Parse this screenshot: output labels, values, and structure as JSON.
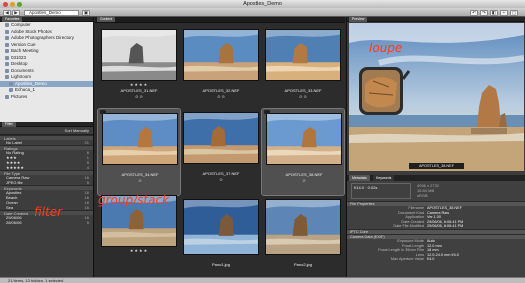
{
  "window": {
    "title": "Apostles_Demo"
  },
  "toolbar": {
    "path_label": "Apostles_Demo",
    "back_label": "◀",
    "fwd_label": "▶"
  },
  "left": {
    "folders_tab": "Favorites",
    "folders": [
      {
        "label": "Computer"
      },
      {
        "label": "Adobe Stock Photos"
      },
      {
        "label": "Adobe Photographers Directory"
      },
      {
        "label": "Version Cue"
      },
      {
        "label": "Bach Meeting"
      },
      {
        "label": "031023"
      },
      {
        "label": "Desktop"
      },
      {
        "label": "Documents"
      },
      {
        "label": "Lightroom"
      },
      {
        "label": "Apostles_Demo",
        "selected": true
      },
      {
        "label": "Echuca_1"
      },
      {
        "label": "Pictures"
      }
    ],
    "filter_tab": "Filter",
    "sort_label": "Sort Manually",
    "groups": [
      {
        "title": "Labels",
        "rows": [
          {
            "label": "No Label",
            "count": "21"
          }
        ]
      },
      {
        "title": "Ratings",
        "rows": [
          {
            "label": "No Rating",
            "count": "6"
          },
          {
            "label": "★★★",
            "count": "1"
          },
          {
            "label": "★★★★",
            "count": "5"
          },
          {
            "label": "★★★★★",
            "count": "4"
          }
        ]
      },
      {
        "title": "File Type",
        "rows": [
          {
            "label": "Camera Raw",
            "count": "16"
          },
          {
            "label": "JPEG file",
            "count": "5"
          }
        ]
      },
      {
        "title": "Keywords",
        "rows": [
          {
            "label": "Apostles",
            "count": "16"
          },
          {
            "label": "Beach",
            "count": "16"
          },
          {
            "label": "Ocean",
            "count": "16"
          },
          {
            "label": "Sea",
            "count": "16"
          }
        ]
      },
      {
        "title": "Date Created",
        "rows": [
          {
            "label": "29/06/06",
            "count": "16"
          },
          {
            "label": "28/06/06",
            "count": "5"
          }
        ]
      }
    ],
    "filter_annotation": "filter"
  },
  "center": {
    "tab": "Content",
    "cells": [
      {
        "caption": "APOSTLES_31.NEF",
        "stars": "★★★★",
        "badges": "⊘ ⊘",
        "stack": false
      },
      {
        "caption": "APOSTLES_32.NEF",
        "stars": "",
        "badges": "⊘ ⊘",
        "stack": false
      },
      {
        "caption": "APOSTLES_33.NEF",
        "stars": "",
        "badges": "⊘ ⊘",
        "stack": false
      },
      {
        "caption": "APOSTLES_34.NEF",
        "stars": "",
        "badges": "⊘",
        "stack": true
      },
      {
        "caption": "APOSTLES_37.NEF",
        "stars": "",
        "badges": "⊘",
        "stack": false
      },
      {
        "caption": "APOSTLES_38.NEF",
        "stars": "",
        "badges": "⊘",
        "stack": true
      },
      {
        "caption": "",
        "stars": "★★★★",
        "badges": "",
        "stack": false
      },
      {
        "caption": "Pano1.jpg",
        "stars": "",
        "badges": "",
        "stack": false
      },
      {
        "caption": "Pano2.jpg",
        "stars": "",
        "badges": "",
        "stack": false
      }
    ],
    "stack_annotation": "group/stack"
  },
  "right": {
    "preview_tab": "Preview",
    "loupe_annotation": "loupe",
    "preview_caption": "APOSTLES_38.NEF",
    "meta_tabs": [
      "Metadata",
      "Keywords"
    ],
    "camera": {
      "aperture": "f/14.0",
      "shutter": "0.02s",
      "focal": "4096 x 2732",
      "size": "15.84 MB",
      "color": "sRGB"
    },
    "sections": [
      {
        "title": "File Properties",
        "rows": [
          {
            "k": "Filename",
            "v": "APOSTLES_38.NEF"
          },
          {
            "k": "Document Kind",
            "v": "Camera Raw"
          },
          {
            "k": "Application",
            "v": "Ver.1.00"
          },
          {
            "k": "Date Created",
            "v": "29/06/06, 6:06:41 PM"
          },
          {
            "k": "Date File Modified",
            "v": "29/06/06, 6:06:41 PM"
          }
        ]
      },
      {
        "title": "IPTC Core",
        "rows": []
      },
      {
        "title": "Camera Data (EXIF)",
        "rows": [
          {
            "k": "Exposure Mode",
            "v": "Auto"
          },
          {
            "k": "Focal Length",
            "v": "12.0 mm"
          },
          {
            "k": "Focal Length in 35mm Film",
            "v": "18 mm"
          },
          {
            "k": "Lens",
            "v": "12.0-24.0 mm f/4.0"
          },
          {
            "k": "Max Aperture Value",
            "v": "f/4.0"
          }
        ]
      }
    ]
  },
  "status": {
    "text": "21 items, 13 hidden, 1 selected"
  }
}
